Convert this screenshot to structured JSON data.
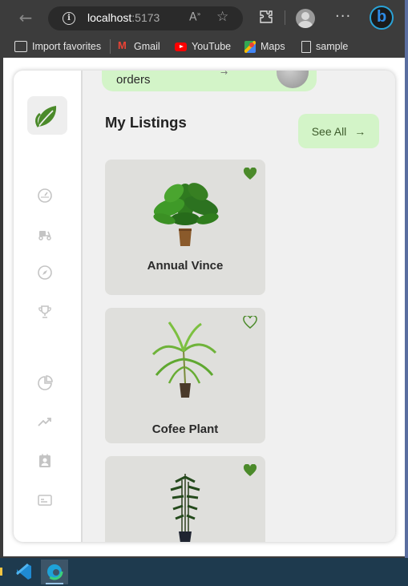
{
  "browser": {
    "url_host": "localhost",
    "url_port": ":5173",
    "favorites": [
      {
        "label": "Import favorites",
        "icon": "import-icon"
      },
      {
        "label": "Gmail",
        "icon": "gmail-icon"
      },
      {
        "label": "YouTube",
        "icon": "youtube-icon"
      },
      {
        "label": "Maps",
        "icon": "maps-icon"
      },
      {
        "label": "sample",
        "icon": "page-icon"
      }
    ]
  },
  "sidebar": {
    "logo_icon": "leaf-icon",
    "items": [
      {
        "icon": "speedometer-icon"
      },
      {
        "icon": "delivery-scooter-icon"
      },
      {
        "icon": "compass-icon"
      },
      {
        "icon": "trophy-icon"
      },
      {
        "icon": "pie-chart-icon"
      },
      {
        "icon": "trending-up-icon"
      },
      {
        "icon": "contact-card-icon"
      },
      {
        "icon": "billing-card-icon"
      }
    ]
  },
  "main": {
    "banner_text": "orders",
    "section_title": "My Listings",
    "see_all_label": "See All",
    "listings": [
      {
        "name": "Annual Vince",
        "favorited": true
      },
      {
        "name": "Cofee Plant",
        "favorited": false
      },
      {
        "name": "",
        "favorited": true
      }
    ]
  },
  "colors": {
    "accent_green": "#4b8a2a",
    "banner_bg": "#d3f4c8",
    "card_bg": "#dfdfdc"
  }
}
